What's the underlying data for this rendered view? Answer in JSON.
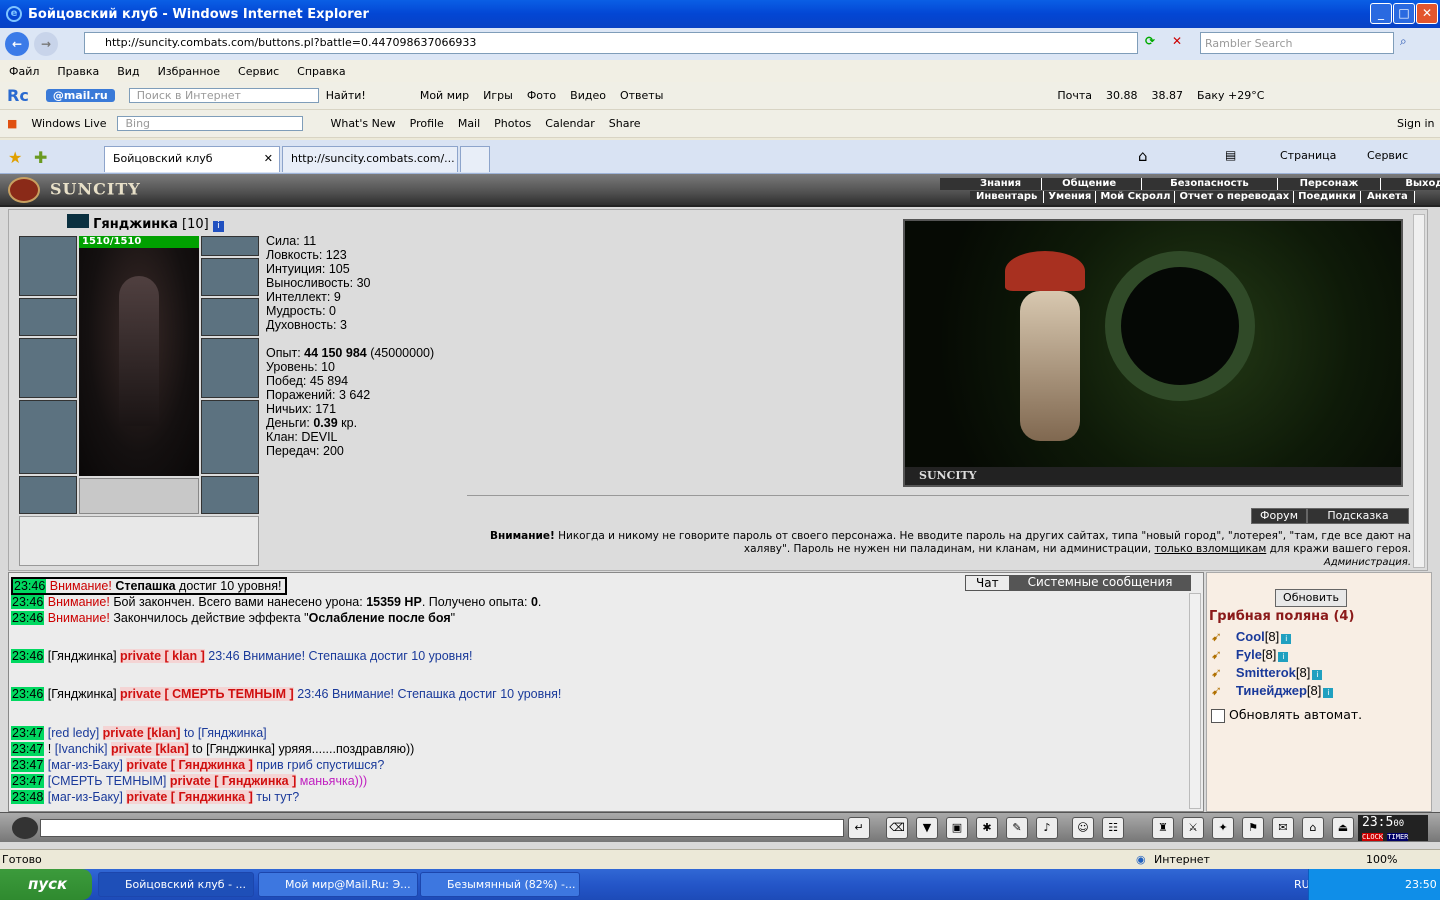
{
  "window": {
    "title": "Бойцовский клуб - Windows Internet Explorer"
  },
  "browser": {
    "url": "http://suncity.combats.com/buttons.pl?battle=0.447098637066933",
    "search_placeholder": "Rambler Search",
    "menu": [
      "Файл",
      "Правка",
      "Вид",
      "Избранное",
      "Сервис",
      "Справка"
    ],
    "mailru_bar": {
      "logo": "@mail.ru",
      "search_placeholder": "Поиск в Интернет",
      "find": "Найти!",
      "items": [
        "Мой мир",
        "Игры",
        "Фото",
        "Видео",
        "Ответы"
      ],
      "right": [
        "Почта",
        "30.88",
        "38.87",
        "Баку +29°C"
      ]
    },
    "live_bar": {
      "brand": "Windows Live",
      "search_placeholder": "Bing",
      "items": [
        "What's New",
        "Profile",
        "Mail",
        "Photos",
        "Calendar",
        "Share"
      ],
      "signin": "Sign in"
    },
    "tabs": [
      "Бойцовский клуб",
      "http://suncity.combats.com/..."
    ],
    "tab_tools": [
      "Страница",
      "Сервис"
    ]
  },
  "game": {
    "logo": "SUNCITY",
    "menu_top": [
      "Знания",
      "Общение",
      "Безопасность",
      "Персонаж",
      "Выход"
    ],
    "menu_bottom": [
      "Инвентарь",
      "Умения",
      "Мой Скролл",
      "Отчет о переводах",
      "Поединки",
      "Анкета"
    ],
    "character": {
      "name": "Гянджинка",
      "level": "[10]",
      "hp": "1510/1510"
    },
    "stats": [
      "Сила: 11",
      "Ловкость: 123",
      "Интуиция: 105",
      "Выносливость: 30",
      "Интеллект: 9",
      "Мудрость: 0",
      "Духовность: 3"
    ],
    "exp_label": "Опыт: ",
    "exp_value": "44 150 984",
    "exp_next": " (45000000)",
    "stats2": [
      "Уровень: 10",
      "Побед: 45 894",
      "Поражений: 3 642",
      "Ничьих: 171"
    ],
    "money_label": "Деньги: ",
    "money_value": "0.39",
    "money_unit": " кр.",
    "stats3": [
      "Клан: DEVIL",
      "Передач: 200"
    ],
    "art_caption": "SUNCITY",
    "buttons": [
      "Форум",
      "Подсказка"
    ],
    "warning_bold": "Внимание!",
    "warning": " Никогда и никому не говорите пароль от своего персонажа. Не вводите пароль на других сайтах, типа \"новый город\", \"лотерея\", \"там, где все дают на халяву\". Пароль не нужен ни паладинам, ни кланам, ни администрации, ",
    "warning_link": "только взломщикам",
    "warning_end": " для кражи вашего героя.",
    "warning_sign": "Администрация."
  },
  "chat": {
    "tabs": [
      "Чат",
      "Системные сообщения"
    ],
    "lines": [
      {
        "time": "23:46",
        "parts": [
          {
            "c": "red",
            "t": "Внимание! "
          },
          {
            "c": "b",
            "t": "Степашка"
          },
          {
            "c": "",
            "t": " достиг 10 уровня!"
          }
        ]
      },
      {
        "time": "23:46",
        "parts": [
          {
            "c": "red",
            "t": "Внимание! "
          },
          {
            "c": "",
            "t": "Бой закончен. Всего вами нанесено урона: "
          },
          {
            "c": "b",
            "t": "15359 HP"
          },
          {
            "c": "",
            "t": ". Получено опыта: "
          },
          {
            "c": "b",
            "t": "0"
          },
          {
            "c": "",
            "t": "."
          }
        ]
      },
      {
        "time": "23:46",
        "parts": [
          {
            "c": "red",
            "t": "Внимание! "
          },
          {
            "c": "",
            "t": "Закончилось действие эффекта \""
          },
          {
            "c": "b",
            "t": "Ослабление после боя"
          },
          {
            "c": "",
            "t": "\""
          }
        ]
      },
      {
        "time": "23:46",
        "parts": [
          {
            "c": "",
            "t": "[Гянджинка] "
          },
          {
            "c": "prv",
            "t": "private [ klan ]"
          },
          {
            "c": "blu",
            "t": " 23:46 Внимание! Степашка достиг 10 уровня!"
          }
        ]
      },
      {
        "time": "23:46",
        "parts": [
          {
            "c": "",
            "t": "[Гянджинка] "
          },
          {
            "c": "prv",
            "t": "private [ СМЕРТЬ ТЕМНЫМ ]"
          },
          {
            "c": "blu",
            "t": " 23:46 Внимание! Степашка достиг 10 уровня!"
          }
        ]
      },
      {
        "time": "23:47",
        "parts": [
          {
            "c": "blu",
            "t": "[red ledy] "
          },
          {
            "c": "prv",
            "t": "private [klan]"
          },
          {
            "c": "blu",
            "t": " to [Гянджинка]"
          }
        ]
      },
      {
        "time": "23:47",
        "parts": [
          {
            "c": "",
            "t": "! "
          },
          {
            "c": "blu",
            "t": "[Ivanchik] "
          },
          {
            "c": "prv",
            "t": "private [klan]"
          },
          {
            "c": "",
            "t": " to [Гянджинка] уряяя.......поздравляю))"
          }
        ]
      },
      {
        "time": "23:47",
        "parts": [
          {
            "c": "blu",
            "t": "[маг-из-Баку] "
          },
          {
            "c": "prv",
            "t": "private [ Гянджинка ]"
          },
          {
            "c": "blu",
            "t": " прив гриб спустишся?"
          }
        ]
      },
      {
        "time": "23:47",
        "parts": [
          {
            "c": "blu",
            "t": "[СМЕРТЬ ТЕМНЫМ] "
          },
          {
            "c": "prv",
            "t": "private [ Гянджинка ]"
          },
          {
            "c": "mag",
            "t": " маньячка)))"
          }
        ]
      },
      {
        "time": "23:48",
        "parts": [
          {
            "c": "blu",
            "t": "[маг-из-Баку] "
          },
          {
            "c": "prv",
            "t": "private [ Гянджинка ]"
          },
          {
            "c": "blu",
            "t": " ты тут?"
          }
        ]
      }
    ]
  },
  "sidebar": {
    "refresh": "Обновить",
    "location": "Грибная поляна (4)",
    "players": [
      {
        "name": "Cool",
        "lvl": "[8]"
      },
      {
        "name": "Fyle",
        "lvl": "[8]"
      },
      {
        "name": "Smitterok",
        "lvl": "[8]"
      },
      {
        "name": "Тинейджер",
        "lvl": "[8]"
      }
    ],
    "auto": "Обновлять автомат."
  },
  "clock": {
    "time": "23:5",
    "sec": "00",
    "labels": [
      "CLOCK",
      "TIMER"
    ]
  },
  "status": {
    "left": "Готово",
    "zone": "Интернет",
    "zoom": "100%"
  },
  "taskbar": {
    "start": "пуск",
    "tasks": [
      "Бойцовский клуб - ...",
      "Мой мир@Mail.Ru: Э...",
      "Безымянный (82%) -..."
    ],
    "lang": "RU",
    "time": "23:50"
  }
}
